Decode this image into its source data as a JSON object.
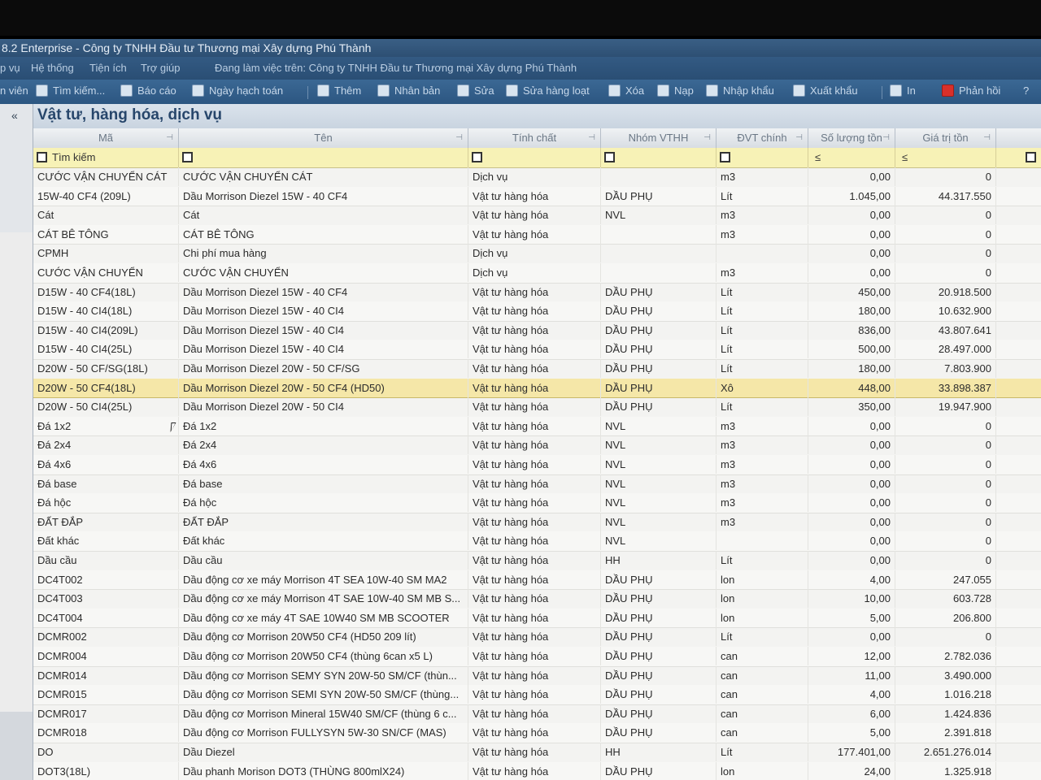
{
  "window": {
    "title": "8.2 Enterprise - Công ty TNHH Đầu tư Thương mại Xây dựng Phú Thành"
  },
  "menu": {
    "items": [
      "p vụ",
      "Hệ thống",
      "Tiện ích",
      "Trợ giúp"
    ],
    "working_on": "Đang làm việc trên: Công ty TNHH Đầu tư Thương mại Xây dựng Phú Thành"
  },
  "toolbar": {
    "left_label": "n viên",
    "search": "Tìm kiếm...",
    "report": "Báo cáo",
    "posting_date": "Ngày hạch toán",
    "add": "Thêm",
    "duplicate": "Nhân bản",
    "edit": "Sửa",
    "bulk_edit": "Sửa hàng loạt",
    "delete": "Xóa",
    "load": "Nạp",
    "import": "Nhập khẩu",
    "export": "Xuất khẩu",
    "print": "In",
    "feedback": "Phản hồi",
    "help": "?"
  },
  "panel": {
    "title": "Vật tư, hàng hóa, dịch vụ",
    "collapse": "«"
  },
  "columns": {
    "code": "Mã",
    "name": "Tên",
    "property": "Tính chất",
    "group": "Nhóm VTHH",
    "unit": "ĐVT chính",
    "qty": "Số lượng tồn",
    "value": "Giá trị tồn"
  },
  "filter": {
    "search_label": "Tìm kiếm",
    "qty_op": "≤",
    "value_op": "≤"
  },
  "rows": [
    {
      "code": "CƯỚC VẬN CHUYỂN CÁT",
      "name": "CƯỚC VẬN CHUYỂN CÁT",
      "property": "Dịch vụ",
      "group": "",
      "unit": "m3",
      "qty": "0,00",
      "value": "0"
    },
    {
      "code": "15W-40 CF4 (209L)",
      "name": "Dầu Morrison Diezel 15W - 40 CF4",
      "property": "Vật tư hàng hóa",
      "group": "DẦU PHỤ",
      "unit": "Lít",
      "qty": "1.045,00",
      "value": "44.317.550"
    },
    {
      "code": "Cát",
      "name": "Cát",
      "property": "Vật tư hàng hóa",
      "group": "NVL",
      "unit": "m3",
      "qty": "0,00",
      "value": "0"
    },
    {
      "code": "CÁT BÊ TÔNG",
      "name": "CÁT BÊ TÔNG",
      "property": "Vật tư hàng hóa",
      "group": "",
      "unit": "m3",
      "qty": "0,00",
      "value": "0"
    },
    {
      "code": "CPMH",
      "name": "Chi phí mua hàng",
      "property": "Dịch vụ",
      "group": "",
      "unit": "",
      "qty": "0,00",
      "value": "0"
    },
    {
      "code": "CƯỚC VẬN CHUYỂN",
      "name": "CƯỚC VẬN CHUYỂN",
      "property": "Dịch vụ",
      "group": "",
      "unit": "m3",
      "qty": "0,00",
      "value": "0"
    },
    {
      "code": "D15W - 40 CF4(18L)",
      "name": "Dầu Morrison Diezel 15W - 40 CF4",
      "property": "Vật tư hàng hóa",
      "group": "DẦU PHỤ",
      "unit": "Lít",
      "qty": "450,00",
      "value": "20.918.500"
    },
    {
      "code": "D15W - 40 CI4(18L)",
      "name": "Dầu Morrison Diezel 15W - 40 CI4",
      "property": "Vật tư hàng hóa",
      "group": "DẦU PHỤ",
      "unit": "Lít",
      "qty": "180,00",
      "value": "10.632.900"
    },
    {
      "code": "D15W - 40 CI4(209L)",
      "name": "Dầu Morrison Diezel 15W - 40 CI4",
      "property": "Vật tư hàng hóa",
      "group": "DẦU PHỤ",
      "unit": "Lít",
      "qty": "836,00",
      "value": "43.807.641"
    },
    {
      "code": "D15W - 40 CI4(25L)",
      "name": "Dầu Morrison Diezel 15W - 40 CI4",
      "property": "Vật tư hàng hóa",
      "group": "DẦU PHỤ",
      "unit": "Lít",
      "qty": "500,00",
      "value": "28.497.000"
    },
    {
      "code": "D20W - 50 CF/SG(18L)",
      "name": "Dầu Morrison Diezel 20W - 50 CF/SG",
      "property": "Vật tư hàng hóa",
      "group": "DẦU PHỤ",
      "unit": "Lít",
      "qty": "180,00",
      "value": "7.803.900"
    },
    {
      "code": "D20W - 50 CF4(18L)",
      "name": "Dầu Morrison Diezel 20W - 50 CF4 (HD50)",
      "property": "Vật tư hàng hóa",
      "group": "DẦU PHỤ",
      "unit": "Xô",
      "qty": "448,00",
      "value": "33.898.387"
    },
    {
      "code": "D20W - 50 CI4(25L)",
      "name": "Dầu Morrison Diezel 20W - 50 CI4",
      "property": "Vật tư hàng hóa",
      "group": "DẦU PHỤ",
      "unit": "Lít",
      "qty": "350,00",
      "value": "19.947.900"
    },
    {
      "code": "Đá 1x2",
      "name": "Đá 1x2",
      "property": "Vật tư hàng hóa",
      "group": "NVL",
      "unit": "m3",
      "qty": "0,00",
      "value": "0"
    },
    {
      "code": "Đá 2x4",
      "name": "Đá 2x4",
      "property": "Vật tư hàng hóa",
      "group": "NVL",
      "unit": "m3",
      "qty": "0,00",
      "value": "0"
    },
    {
      "code": "Đá 4x6",
      "name": "Đá 4x6",
      "property": "Vật tư hàng hóa",
      "group": "NVL",
      "unit": "m3",
      "qty": "0,00",
      "value": "0"
    },
    {
      "code": "Đá base",
      "name": "Đá base",
      "property": "Vật tư hàng hóa",
      "group": "NVL",
      "unit": "m3",
      "qty": "0,00",
      "value": "0"
    },
    {
      "code": "Đá hộc",
      "name": "Đá hộc",
      "property": "Vật tư hàng hóa",
      "group": "NVL",
      "unit": "m3",
      "qty": "0,00",
      "value": "0"
    },
    {
      "code": "ĐẤT ĐẮP",
      "name": "ĐẤT ĐẮP",
      "property": "Vật tư hàng hóa",
      "group": "NVL",
      "unit": "m3",
      "qty": "0,00",
      "value": "0"
    },
    {
      "code": "Đất khác",
      "name": "Đất khác",
      "property": "Vật tư hàng hóa",
      "group": "NVL",
      "unit": "",
      "qty": "0,00",
      "value": "0"
    },
    {
      "code": "Dầu cầu",
      "name": "Dầu cầu",
      "property": "Vật tư hàng hóa",
      "group": "HH",
      "unit": "Lít",
      "qty": "0,00",
      "value": "0"
    },
    {
      "code": "DC4T002",
      "name": "Dầu động cơ xe máy Morrison 4T SEA 10W-40 SM MA2",
      "property": "Vật tư hàng hóa",
      "group": "DẦU PHỤ",
      "unit": "lon",
      "qty": "4,00",
      "value": "247.055"
    },
    {
      "code": "DC4T003",
      "name": "Dầu động cơ xe máy Morrison 4T SAE 10W-40 SM MB S...",
      "property": "Vật tư hàng hóa",
      "group": "DẦU PHỤ",
      "unit": "lon",
      "qty": "10,00",
      "value": "603.728"
    },
    {
      "code": "DC4T004",
      "name": "Dầu động cơ xe máy 4T SAE 10W40 SM MB SCOOTER",
      "property": "Vật tư hàng hóa",
      "group": "DẦU PHỤ",
      "unit": "lon",
      "qty": "5,00",
      "value": "206.800"
    },
    {
      "code": "DCMR002",
      "name": "Dầu động cơ Morrison 20W50 CF4 (HD50 209 lít)",
      "property": "Vật tư hàng hóa",
      "group": "DẦU PHỤ",
      "unit": "Lít",
      "qty": "0,00",
      "value": "0"
    },
    {
      "code": "DCMR004",
      "name": "Dầu động cơ Morrison 20W50 CF4 (thùng 6can x5 L)",
      "property": "Vật tư hàng hóa",
      "group": "DẦU PHỤ",
      "unit": "can",
      "qty": "12,00",
      "value": "2.782.036"
    },
    {
      "code": "DCMR014",
      "name": "Dầu động cơ Morrison SEMY SYN 20W-50 SM/CF (thùn...",
      "property": "Vật tư hàng hóa",
      "group": "DẦU PHỤ",
      "unit": "can",
      "qty": "11,00",
      "value": "3.490.000"
    },
    {
      "code": "DCMR015",
      "name": "Dầu động cơ Morrison SEMI SYN 20W-50 SM/CF (thùng...",
      "property": "Vật tư hàng hóa",
      "group": "DẦU PHỤ",
      "unit": "can",
      "qty": "4,00",
      "value": "1.016.218"
    },
    {
      "code": "DCMR017",
      "name": "Dầu động cơ Morrison Mineral 15W40 SM/CF (thùng 6 c...",
      "property": "Vật tư hàng hóa",
      "group": "DẦU PHỤ",
      "unit": "can",
      "qty": "6,00",
      "value": "1.424.836"
    },
    {
      "code": "DCMR018",
      "name": "Dầu động cơ Morrison FULLYSYN 5W-30 SN/CF (MAS)",
      "property": "Vật tư hàng hóa",
      "group": "DẦU PHỤ",
      "unit": "can",
      "qty": "5,00",
      "value": "2.391.818"
    },
    {
      "code": "DO",
      "name": "Dầu Diezel",
      "property": "Vật tư hàng hóa",
      "group": "HH",
      "unit": "Lít",
      "qty": "177.401,00",
      "value": "2.651.276.014"
    },
    {
      "code": "DOT3(18L)",
      "name": "Dầu phanh Morison DOT3 (THÙNG 800mlX24)",
      "property": "Vật tư hàng hóa",
      "group": "DẦU PHỤ",
      "unit": "lon",
      "qty": "24,00",
      "value": "1.325.918"
    }
  ],
  "selected_row": 11
}
